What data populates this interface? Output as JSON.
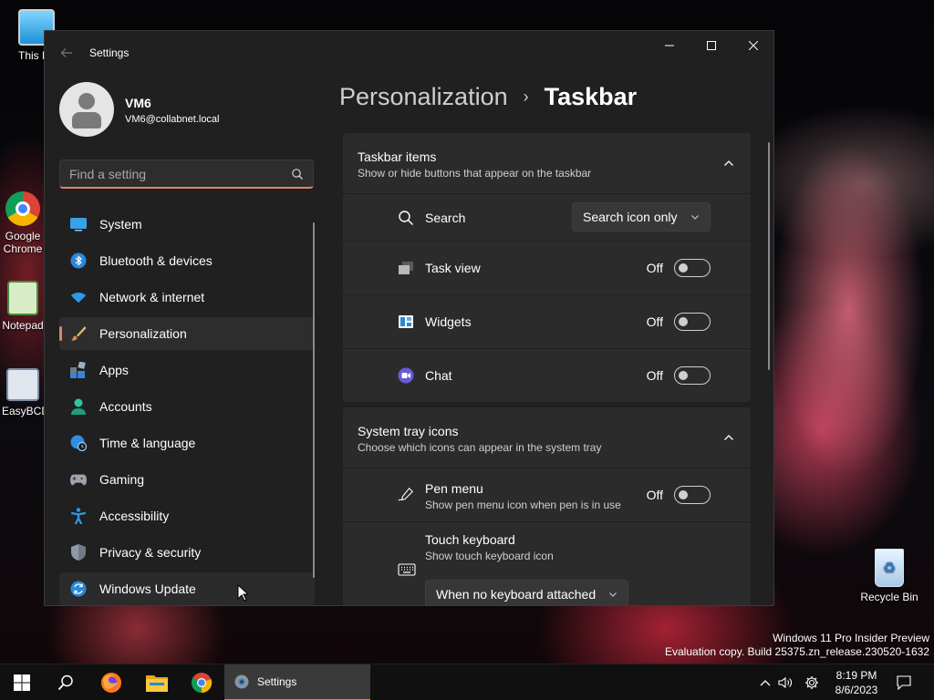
{
  "desktop": {
    "icons": [
      {
        "label": "This PC"
      },
      {
        "label": "Google Chrome"
      },
      {
        "label": "Notepad"
      },
      {
        "label": "EasyBCD"
      },
      {
        "label": "Recycle Bin"
      }
    ],
    "watermark": {
      "line1": "Windows 11 Pro Insider Preview",
      "line2": "Evaluation copy. Build 25375.zn_release.230520-1632"
    }
  },
  "window": {
    "title": "Settings",
    "controls": {
      "minimize": "minimize-icon",
      "maximize": "maximize-icon",
      "close": "close-icon"
    }
  },
  "profile": {
    "name": "VM6",
    "email": "VM6@collabnet.local"
  },
  "search": {
    "placeholder": "Find a setting"
  },
  "nav": {
    "items": [
      {
        "label": "System",
        "icon": "system-icon"
      },
      {
        "label": "Bluetooth & devices",
        "icon": "bluetooth-icon"
      },
      {
        "label": "Network & internet",
        "icon": "wifi-icon"
      },
      {
        "label": "Personalization",
        "icon": "brush-icon",
        "active": true
      },
      {
        "label": "Apps",
        "icon": "apps-icon"
      },
      {
        "label": "Accounts",
        "icon": "accounts-icon"
      },
      {
        "label": "Time & language",
        "icon": "globe-clock-icon"
      },
      {
        "label": "Gaming",
        "icon": "gamepad-icon"
      },
      {
        "label": "Accessibility",
        "icon": "accessibility-icon"
      },
      {
        "label": "Privacy & security",
        "icon": "shield-icon"
      },
      {
        "label": "Windows Update",
        "icon": "update-icon",
        "hover": true
      }
    ]
  },
  "breadcrumb": {
    "parent": "Personalization",
    "separator": "›",
    "current": "Taskbar"
  },
  "taskbar_items": {
    "title": "Taskbar items",
    "subtitle": "Show or hide buttons that appear on the taskbar",
    "search": {
      "label": "Search",
      "value": "Search icon only"
    },
    "task_view": {
      "label": "Task view",
      "state": "Off"
    },
    "widgets": {
      "label": "Widgets",
      "state": "Off"
    },
    "chat": {
      "label": "Chat",
      "state": "Off"
    }
  },
  "system_tray": {
    "title": "System tray icons",
    "subtitle": "Choose which icons can appear in the system tray",
    "pen_menu": {
      "label": "Pen menu",
      "description": "Show pen menu icon when pen is in use",
      "state": "Off"
    },
    "touch_keyboard": {
      "label": "Touch keyboard",
      "description": "Show touch keyboard icon",
      "value": "When no keyboard attached"
    }
  },
  "os_taskbar": {
    "active_app": "Settings",
    "time": "8:19 PM",
    "date": "8/6/2023"
  },
  "colors": {
    "accent": "#e2816a",
    "window_bg": "#202020",
    "card_bg": "#2b2b2b"
  }
}
